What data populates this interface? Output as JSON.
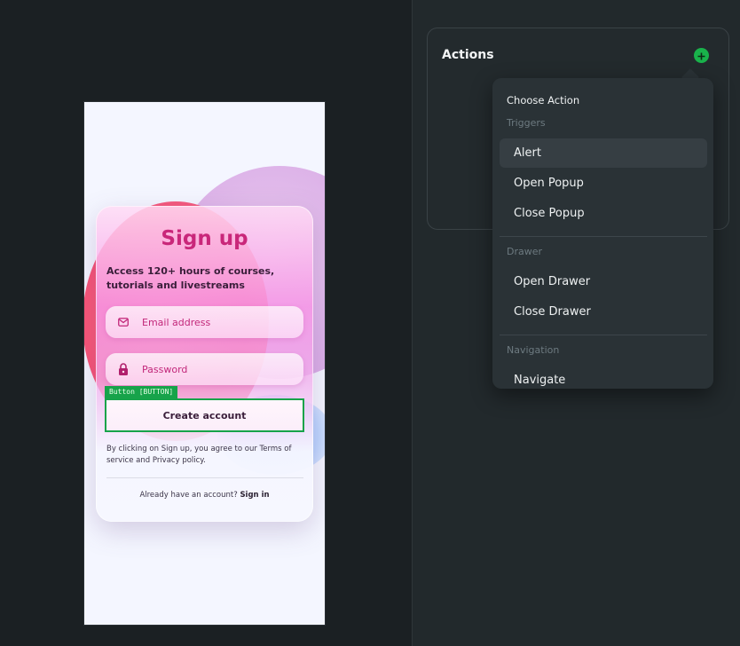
{
  "signup": {
    "title": "Sign up",
    "subtitle": "Access 120+ hours of courses, tutorials and livestreams",
    "email_placeholder": "Email address",
    "password_placeholder": "Password",
    "selection_tag": "Button [BUTTON]",
    "create_label": "Create account",
    "legal": "By clicking on Sign up, you agree to our Terms of service and Privacy policy.",
    "footer_prefix": "Already have an account?",
    "signin_label": "Sign in"
  },
  "actions_panel": {
    "title": "Actions",
    "dropdown": {
      "header": "Choose Action",
      "groups": [
        {
          "label": "Triggers",
          "items": [
            "Alert",
            "Open Popup",
            "Close Popup"
          ]
        },
        {
          "label": "Drawer",
          "items": [
            "Open Drawer",
            "Close Drawer"
          ]
        },
        {
          "label": "Navigation",
          "items": [
            "Navigate"
          ]
        }
      ],
      "active_item": "Alert"
    }
  },
  "colors": {
    "selection": "#17a34a",
    "accent_pink": "#c9277a",
    "add_button": "#19b24b"
  },
  "icons": {
    "email": "mail-icon",
    "password": "lock-icon",
    "add": "plus-icon"
  }
}
